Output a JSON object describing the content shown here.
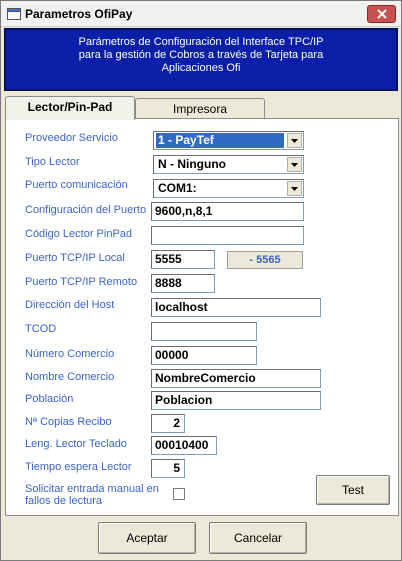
{
  "window": {
    "title": "Parametros OfiPay",
    "close_icon": "close-icon"
  },
  "banner": {
    "line1": "Parámetros de Configuración del Interface TPC/IP",
    "line2": "para la gestión de Cobros a través de Tarjeta para",
    "line3": "Aplicaciones Ofi"
  },
  "tabs": [
    {
      "label": "Lector/Pin-Pad",
      "active": true
    },
    {
      "label": "Impresora",
      "active": false
    }
  ],
  "form": {
    "proveedor": {
      "label": "Proveedor Servicio",
      "value": "1 - PayTef"
    },
    "tipo_lector": {
      "label": "Tipo Lector",
      "value": "N - Ninguno"
    },
    "puerto_com": {
      "label": "Puerto comunicación",
      "value": "COM1:"
    },
    "config_puerto": {
      "label": "Configuración del Puerto",
      "value": "9600,n,8,1"
    },
    "codigo_pinpad": {
      "label": "Código Lector PinPad",
      "value": ""
    },
    "tcp_local": {
      "label": "Puerto TCP/IP Local",
      "value": "5555",
      "remote_display": "- 5565"
    },
    "tcp_remoto": {
      "label": "Puerto TCP/IP Remoto",
      "value": "8888"
    },
    "host": {
      "label": "Dirección del Host",
      "value": "localhost"
    },
    "tcod": {
      "label": "TCOD",
      "value": ""
    },
    "num_comercio": {
      "label": "Número Comercio",
      "value": "00000"
    },
    "nombre_comercio": {
      "label": "Nombre Comercio",
      "value": "NombreComercio"
    },
    "poblacion": {
      "label": "Población",
      "value": "Poblacion"
    },
    "copias": {
      "label": "Nª Copias Recibo",
      "value": "2"
    },
    "leng_lector": {
      "label": "Leng. Lector Teclado",
      "value": "00010400"
    },
    "tiempo_espera": {
      "label": "Tiempo espera Lector",
      "value": "5"
    },
    "entrada_manual": {
      "label": "Solicitar entrada manual en fallos de lectura",
      "checked": false
    }
  },
  "buttons": {
    "test": "Test",
    "aceptar": "Aceptar",
    "cancelar": "Cancelar"
  },
  "colors": {
    "banner": "#0a1fa8",
    "label": "#3a64c8",
    "selection": "#316ac5",
    "close": "#c75050"
  }
}
